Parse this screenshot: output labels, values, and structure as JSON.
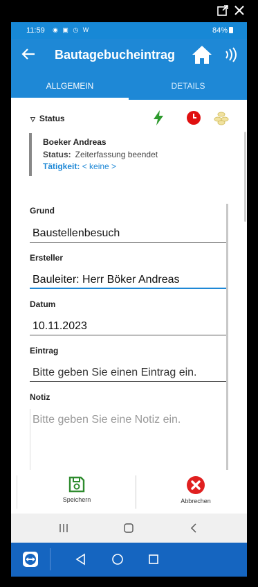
{
  "statusbar": {
    "time": "11:59",
    "left_icons": "◉ ▣ ◷ W",
    "right": "84%"
  },
  "appbar": {
    "title": "Bautagebucheintrag"
  },
  "tabs": [
    {
      "label": "ALLGEMEIN"
    },
    {
      "label": "DETAILS"
    }
  ],
  "status_section": {
    "header": "Status",
    "name": "Boeker Andreas",
    "status_label": "Status:",
    "status_value": "Zeiterfassung beendet",
    "activity_label": "Tätigkeit:",
    "activity_value": "< keine >"
  },
  "fields": [
    {
      "label": "Grund",
      "value": "Baustellenbesuch"
    },
    {
      "label": "Ersteller",
      "value": "Bauleiter: Herr Böker Andreas"
    },
    {
      "label": "Datum",
      "value": "10.11.2023"
    },
    {
      "label": "Eintrag",
      "value": "Bitte geben Sie einen Eintrag ein."
    },
    {
      "label": "Notiz",
      "placeholder": "Bitte geben Sie eine Notiz ein."
    }
  ],
  "actions": {
    "save": "Speichern",
    "cancel": "Abbrechen"
  },
  "colors": {
    "primary": "#1e88d6",
    "save_green": "#2e8b2e",
    "cancel_red": "#e02020",
    "bolt_green": "#2e9a2e",
    "clock_red": "#e01010"
  }
}
